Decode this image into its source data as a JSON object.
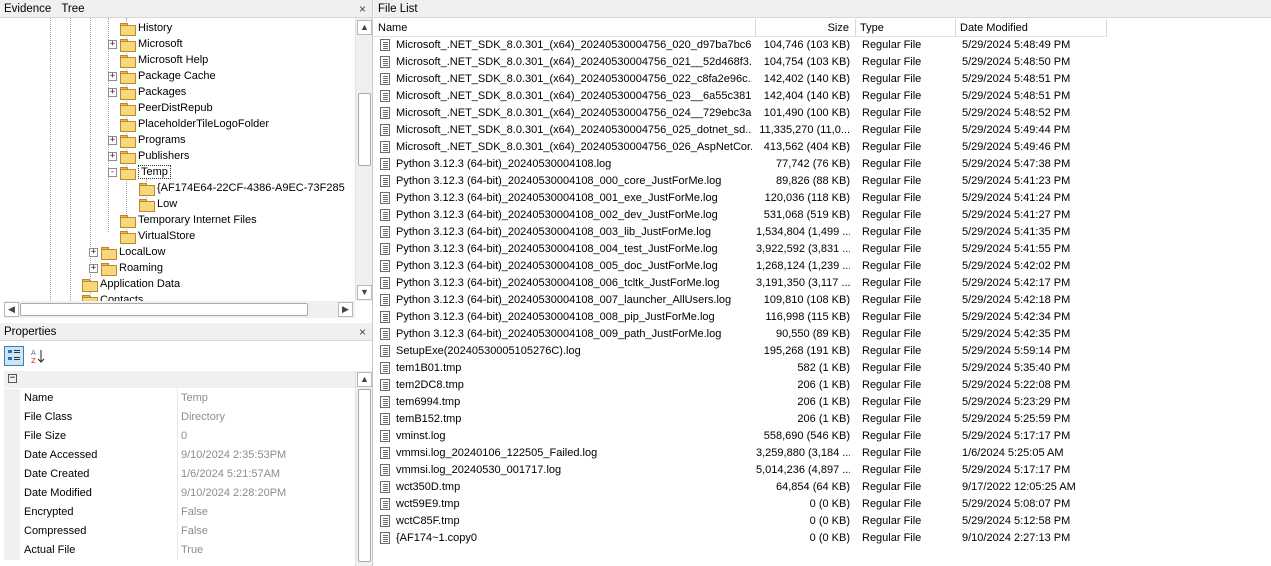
{
  "evidence_panel": {
    "tab1": "Evidence",
    "tab2": "Tree",
    "close": "×"
  },
  "tree": [
    {
      "label": "History",
      "indent": 0,
      "expander": ""
    },
    {
      "label": "Microsoft",
      "indent": 0,
      "expander": "+"
    },
    {
      "label": "Microsoft Help",
      "indent": 0,
      "expander": ""
    },
    {
      "label": "Package Cache",
      "indent": 0,
      "expander": "+"
    },
    {
      "label": "Packages",
      "indent": 0,
      "expander": "+"
    },
    {
      "label": "PeerDistRepub",
      "indent": 0,
      "expander": ""
    },
    {
      "label": "PlaceholderTileLogoFolder",
      "indent": 0,
      "expander": ""
    },
    {
      "label": "Programs",
      "indent": 0,
      "expander": "+"
    },
    {
      "label": "Publishers",
      "indent": 0,
      "expander": "+"
    },
    {
      "label": "Temp",
      "indent": 0,
      "expander": "-"
    },
    {
      "label": "{AF174E64-22CF-4386-A9EC-73F285",
      "indent": 1,
      "expander": ""
    },
    {
      "label": "Low",
      "indent": 1,
      "expander": ""
    },
    {
      "label": "Temporary Internet Files",
      "indent": 0,
      "expander": ""
    },
    {
      "label": "VirtualStore",
      "indent": 0,
      "expander": ""
    },
    {
      "label": "LocalLow",
      "indent": -1,
      "expander": "+"
    },
    {
      "label": "Roaming",
      "indent": -1,
      "expander": "+"
    },
    {
      "label": "Application Data",
      "indent": -2,
      "expander": ""
    },
    {
      "label": "Contacts",
      "indent": -2,
      "expander": ""
    }
  ],
  "properties_panel": {
    "title": "Properties",
    "close": "×",
    "collapse_glyph": "−"
  },
  "properties": [
    {
      "name": "Name",
      "value": "Temp"
    },
    {
      "name": "File Class",
      "value": "Directory"
    },
    {
      "name": "File Size",
      "value": "0"
    },
    {
      "name": "Date Accessed",
      "value": "9/10/2024 2:35:53PM"
    },
    {
      "name": "Date Created",
      "value": "1/6/2024 5:21:57AM"
    },
    {
      "name": "Date Modified",
      "value": "9/10/2024 2:28:20PM"
    },
    {
      "name": "Encrypted",
      "value": "False"
    },
    {
      "name": "Compressed",
      "value": "False"
    },
    {
      "name": "Actual File",
      "value": "True"
    }
  ],
  "file_list": {
    "title": "File List",
    "columns": [
      "Name",
      "Size",
      "Type",
      "Date Modified"
    ],
    "rows": [
      [
        "Microsoft_.NET_SDK_8.0.301_(x64)_20240530004756_020_d97ba7bc6...",
        "104,746 (103 KB)",
        "Regular File",
        "5/29/2024 5:48:49 PM"
      ],
      [
        "Microsoft_.NET_SDK_8.0.301_(x64)_20240530004756_021__52d468f3...",
        "104,754 (103 KB)",
        "Regular File",
        "5/29/2024 5:48:50 PM"
      ],
      [
        "Microsoft_.NET_SDK_8.0.301_(x64)_20240530004756_022_c8fa2e96c...",
        "142,402 (140 KB)",
        "Regular File",
        "5/29/2024 5:48:51 PM"
      ],
      [
        "Microsoft_.NET_SDK_8.0.301_(x64)_20240530004756_023__6a55c381...",
        "142,404 (140 KB)",
        "Regular File",
        "5/29/2024 5:48:51 PM"
      ],
      [
        "Microsoft_.NET_SDK_8.0.301_(x64)_20240530004756_024__729ebc3a...",
        "101,490 (100 KB)",
        "Regular File",
        "5/29/2024 5:48:52 PM"
      ],
      [
        "Microsoft_.NET_SDK_8.0.301_(x64)_20240530004756_025_dotnet_sd...",
        "11,335,270 (11,0...",
        "Regular File",
        "5/29/2024 5:49:44 PM"
      ],
      [
        "Microsoft_.NET_SDK_8.0.301_(x64)_20240530004756_026_AspNetCor...",
        "413,562 (404 KB)",
        "Regular File",
        "5/29/2024 5:49:46 PM"
      ],
      [
        "Python 3.12.3 (64-bit)_20240530004108.log",
        "77,742 (76 KB)",
        "Regular File",
        "5/29/2024 5:47:38 PM"
      ],
      [
        "Python 3.12.3 (64-bit)_20240530004108_000_core_JustForMe.log",
        "89,826 (88 KB)",
        "Regular File",
        "5/29/2024 5:41:23 PM"
      ],
      [
        "Python 3.12.3 (64-bit)_20240530004108_001_exe_JustForMe.log",
        "120,036 (118 KB)",
        "Regular File",
        "5/29/2024 5:41:24 PM"
      ],
      [
        "Python 3.12.3 (64-bit)_20240530004108_002_dev_JustForMe.log",
        "531,068 (519 KB)",
        "Regular File",
        "5/29/2024 5:41:27 PM"
      ],
      [
        "Python 3.12.3 (64-bit)_20240530004108_003_lib_JustForMe.log",
        "1,534,804 (1,499 ...",
        "Regular File",
        "5/29/2024 5:41:35 PM"
      ],
      [
        "Python 3.12.3 (64-bit)_20240530004108_004_test_JustForMe.log",
        "3,922,592 (3,831 ...",
        "Regular File",
        "5/29/2024 5:41:55 PM"
      ],
      [
        "Python 3.12.3 (64-bit)_20240530004108_005_doc_JustForMe.log",
        "1,268,124 (1,239 ...",
        "Regular File",
        "5/29/2024 5:42:02 PM"
      ],
      [
        "Python 3.12.3 (64-bit)_20240530004108_006_tcltk_JustForMe.log",
        "3,191,350 (3,117 ...",
        "Regular File",
        "5/29/2024 5:42:17 PM"
      ],
      [
        "Python 3.12.3 (64-bit)_20240530004108_007_launcher_AllUsers.log",
        "109,810 (108 KB)",
        "Regular File",
        "5/29/2024 5:42:18 PM"
      ],
      [
        "Python 3.12.3 (64-bit)_20240530004108_008_pip_JustForMe.log",
        "116,998 (115 KB)",
        "Regular File",
        "5/29/2024 5:42:34 PM"
      ],
      [
        "Python 3.12.3 (64-bit)_20240530004108_009_path_JustForMe.log",
        "90,550 (89 KB)",
        "Regular File",
        "5/29/2024 5:42:35 PM"
      ],
      [
        "SetupExe(20240530005105276C).log",
        "195,268 (191 KB)",
        "Regular File",
        "5/29/2024 5:59:14 PM"
      ],
      [
        "tem1B01.tmp",
        "582 (1 KB)",
        "Regular File",
        "5/29/2024 5:35:40 PM"
      ],
      [
        "tem2DC8.tmp",
        "206 (1 KB)",
        "Regular File",
        "5/29/2024 5:22:08 PM"
      ],
      [
        "tem6994.tmp",
        "206 (1 KB)",
        "Regular File",
        "5/29/2024 5:23:29 PM"
      ],
      [
        "temB152.tmp",
        "206 (1 KB)",
        "Regular File",
        "5/29/2024 5:25:59 PM"
      ],
      [
        "vminst.log",
        "558,690 (546 KB)",
        "Regular File",
        "5/29/2024 5:17:17 PM"
      ],
      [
        "vmmsi.log_20240106_122505_Failed.log",
        "3,259,880 (3,184 ...",
        "Regular File",
        "1/6/2024 5:25:05 AM"
      ],
      [
        "vmmsi.log_20240530_001717.log",
        "5,014,236 (4,897 ...",
        "Regular File",
        "5/29/2024 5:17:17 PM"
      ],
      [
        "wct350D.tmp",
        "64,854 (64 KB)",
        "Regular File",
        "9/17/2022 12:05:25 AM"
      ],
      [
        "wct59E9.tmp",
        "0 (0 KB)",
        "Regular File",
        "5/29/2024 5:08:07 PM"
      ],
      [
        "wctC85F.tmp",
        "0 (0 KB)",
        "Regular File",
        "5/29/2024 5:12:58 PM"
      ],
      [
        "{AF174~1.copy0",
        "0 (0 KB)",
        "Regular File",
        "9/10/2024 2:27:13 PM"
      ]
    ]
  }
}
